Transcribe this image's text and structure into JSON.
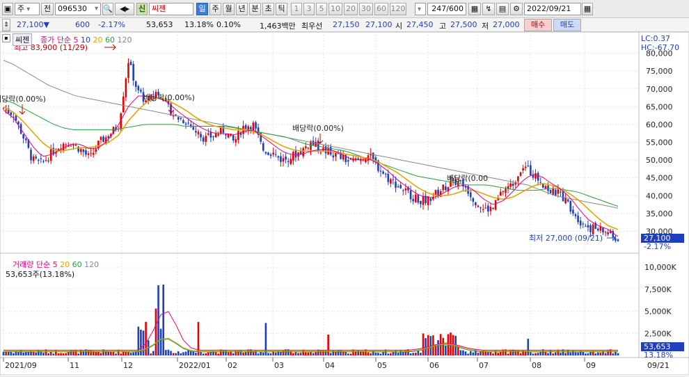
{
  "toolbar": {
    "market_type": "주",
    "prev_label": "전",
    "code": "096530",
    "new_badge": "신",
    "stock_name": "씨젠",
    "periods": [
      "일",
      "주",
      "월",
      "년",
      "분",
      "초",
      "틱"
    ],
    "selected_period": "일",
    "minutes": [
      "1",
      "3",
      "5",
      "10",
      "20",
      "30",
      "60",
      "120"
    ],
    "count": "247/600",
    "date": "2022/09/21"
  },
  "quote": {
    "price": "27,100▼",
    "change": "600",
    "change_pct": "-2.17%",
    "volume": "53,653",
    "volume_pct": "13.18%",
    "turnover": "0.10%",
    "amount": "1,463백만",
    "best_label": "최우선",
    "ask": "27,150",
    "bid": "27,100",
    "open_label": "시",
    "open": "27,450",
    "high_label": "고",
    "high": "27,500",
    "low_label": "저",
    "low": "27,000",
    "buy_label": "매수",
    "sell_label": "매도"
  },
  "legend": {
    "tab": "씨젠",
    "price_label": "종가 단순",
    "ma": [
      "5",
      "10",
      "20",
      "60",
      "120"
    ],
    "ma_colors": [
      "#e6007e",
      "#1f3fbf",
      "#e6a400",
      "#20a040",
      "#888888"
    ],
    "volume_label": "거래량 단순",
    "volume_info": "53,653주(13.18%)",
    "lc": "LC:0.37",
    "hc": "HC:-67.70"
  },
  "annotations": {
    "high": "최고 83,900 (11/29)",
    "low": "최저 27,000 (09/21)",
    "dividend": "배당락(0.00%)",
    "dividend_partial": "배당락(0.00"
  },
  "right_panel": {
    "price_tag": "27,100",
    "pct_tag": "-2.17%",
    "vol_tag": "53,653",
    "volpct_tag": "13.18%"
  },
  "chart_data": {
    "type": "candlestick",
    "price_axis": {
      "min": 25000,
      "max": 85000,
      "ticks": [
        "30,000",
        "35,000",
        "40,000",
        "45,000",
        "50,000",
        "55,000",
        "60,000",
        "65,000",
        "70,000",
        "75,000",
        "80,000"
      ]
    },
    "volume_axis": {
      "ticks": [
        "2,500K",
        "5,000K",
        "7,500K",
        "10,000K"
      ]
    },
    "x_labels": [
      "2021/09",
      "11",
      "12",
      "2022/01",
      "02",
      "03",
      "04",
      "05",
      "06",
      "07",
      "08",
      "09"
    ],
    "x_end_label": "09/21",
    "close_path": [
      64500,
      63000,
      57000,
      50000,
      49000,
      52000,
      54500,
      55000,
      53000,
      50500,
      55000,
      57000,
      60000,
      78000,
      69000,
      66000,
      69500,
      65000,
      62000,
      61000,
      58000,
      56000,
      57000,
      58500,
      55000,
      59500,
      60000,
      53000,
      52000,
      50000,
      51000,
      52500,
      55000,
      53000,
      52000,
      51000,
      49500,
      50000,
      51500,
      48000,
      45000,
      43000,
      41000,
      39000,
      38500,
      40500,
      42500,
      44000,
      43000,
      39000,
      36000,
      36500,
      41500,
      43000,
      48500,
      46500,
      44000,
      41000,
      40500,
      37000,
      33000,
      31000,
      30500,
      29500,
      27100
    ],
    "ma5_path": [
      64000,
      62000,
      58000,
      54000,
      51000,
      51500,
      53000,
      54500,
      54500,
      53000,
      53500,
      56000,
      60000,
      65000,
      68000,
      68000,
      67500,
      66500,
      64000,
      62000,
      60000,
      58500,
      57500,
      57500,
      57000,
      58000,
      58500,
      56500,
      54500,
      52500,
      51500,
      51500,
      52500,
      53000,
      53000,
      52000,
      50500,
      50000,
      50500,
      49000,
      47000,
      44500,
      42500,
      40500,
      39500,
      39500,
      41000,
      42500,
      43000,
      41500,
      39000,
      37500,
      38500,
      41000,
      44000,
      46000,
      45500,
      43500,
      42000,
      39500,
      36000,
      33000,
      31500,
      30500,
      28500
    ],
    "ma20_path": [
      65000,
      63500,
      61000,
      58000,
      55000,
      53000,
      52500,
      53000,
      53500,
      53500,
      54000,
      55000,
      57000,
      61000,
      64000,
      66500,
      67500,
      67000,
      65500,
      64000,
      62000,
      60500,
      59500,
      59000,
      58500,
      58500,
      58000,
      57000,
      55500,
      54000,
      53000,
      52500,
      52500,
      52500,
      52500,
      52000,
      51500,
      51000,
      50500,
      49500,
      48000,
      46500,
      44500,
      42500,
      41000,
      40000,
      40000,
      40500,
      41500,
      41500,
      40500,
      39500,
      39000,
      39500,
      41000,
      42500,
      43500,
      43000,
      42000,
      40500,
      38500,
      36000,
      33500,
      31500,
      30500
    ],
    "ma60_path": [
      67000,
      66000,
      64500,
      63000,
      61500,
      60000,
      59000,
      58500,
      58500,
      58500,
      58500,
      58500,
      59000,
      59500,
      60000,
      60000,
      60000,
      60000,
      59500,
      59500,
      59500,
      59500,
      59500,
      59000,
      58500,
      58000,
      57500,
      57000,
      56500,
      55500,
      54500,
      54000,
      53500,
      53000,
      52500,
      51500,
      50500,
      49500,
      48500,
      47500,
      46500,
      45500,
      45000,
      44500,
      44000,
      43500,
      43000,
      43000,
      43000,
      42500,
      42000,
      41500,
      41500,
      41500,
      42000,
      42000,
      41500,
      41000,
      40000,
      39000,
      38000,
      37000
    ],
    "ma120_path": [
      78000,
      77000,
      75500,
      74000,
      72500,
      71000,
      70000,
      69000,
      68000,
      67500,
      67000,
      66500,
      66000,
      65500,
      65000,
      64500,
      64000,
      63500,
      63000,
      62500,
      62000,
      61500,
      61000,
      60500,
      60000,
      59500,
      59000,
      58500,
      58000,
      57500,
      57000,
      56500,
      56000,
      55500,
      55000,
      54500,
      54000,
      53500,
      53000,
      52500,
      52000,
      51500,
      51000,
      50500,
      50000,
      49500,
      49000,
      48500,
      48000,
      47500,
      47000,
      46500,
      46000,
      45500,
      45000,
      44500,
      44000,
      43500,
      43000,
      42000,
      41000,
      40000,
      39500,
      39000,
      38500,
      38000,
      37500,
      37000,
      36500
    ]
  }
}
